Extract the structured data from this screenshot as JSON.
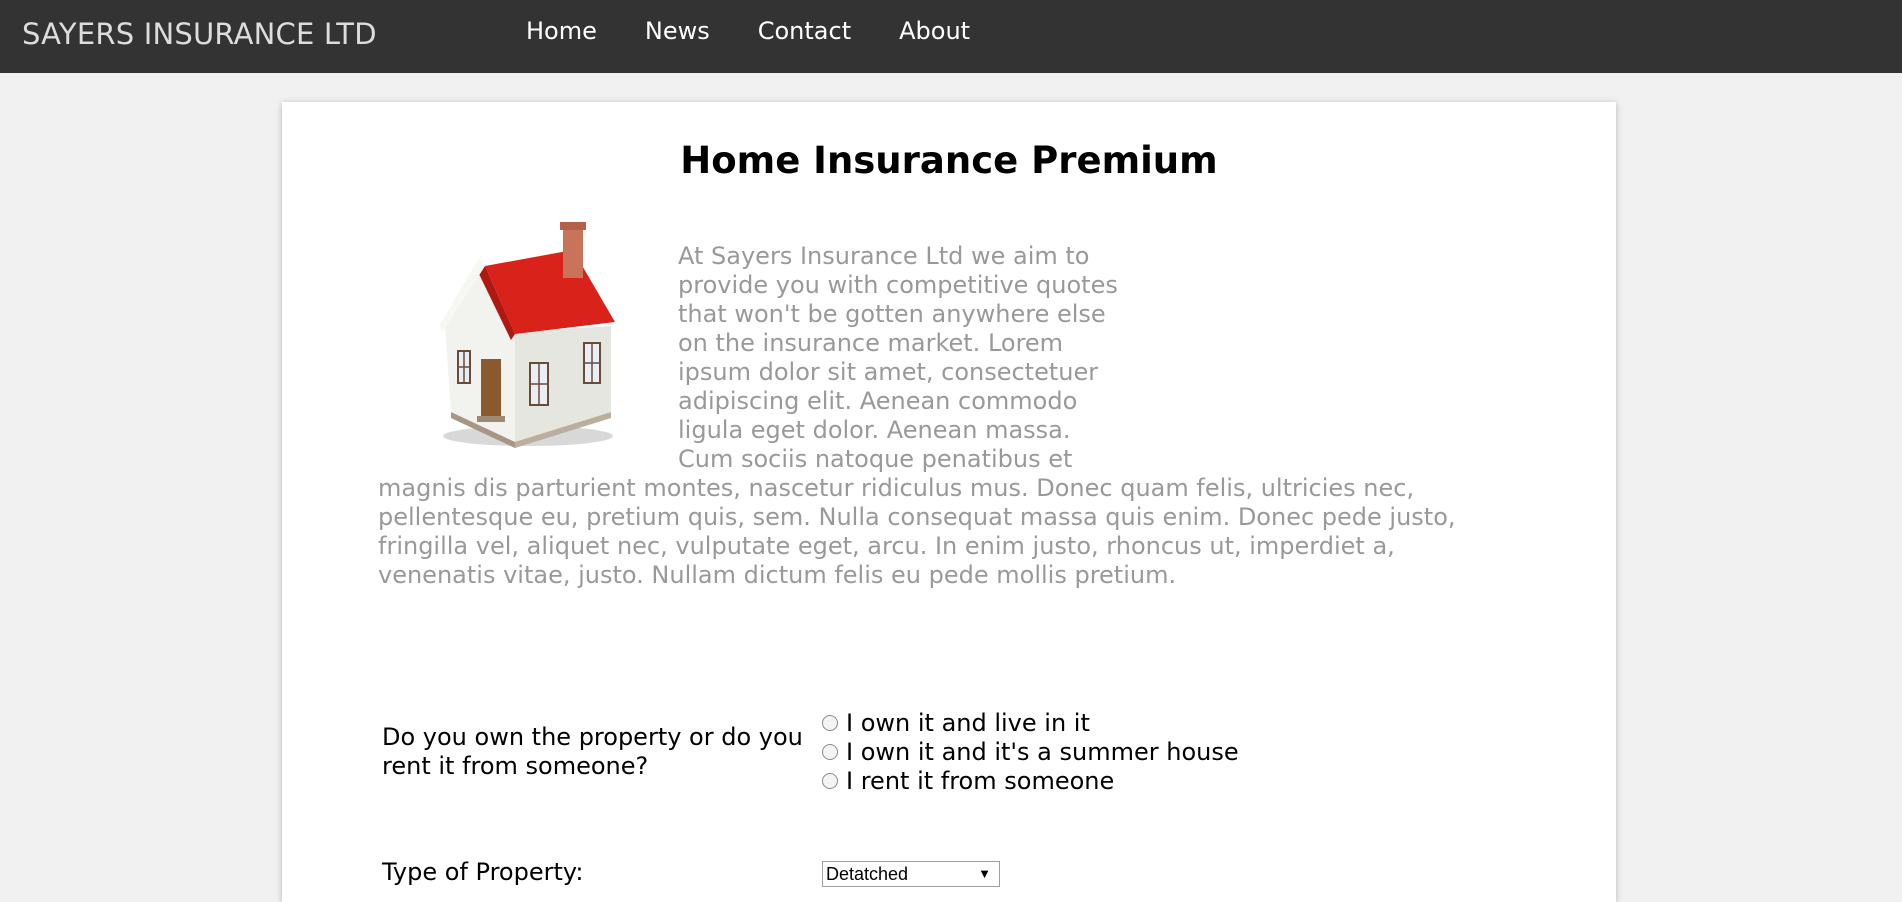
{
  "header": {
    "brand": "SAYERS INSURANCE LTD",
    "nav": [
      "Home",
      "News",
      "Contact",
      "About"
    ]
  },
  "main": {
    "title": "Home Insurance Premium",
    "intro_top": "At Sayers Insurance Ltd we aim to provide you with competitive quotes that won't be gotten anywhere else on the insurance market. Lorem ipsum dolor sit amet, consectetuer adipiscing elit. Aenean commodo ligula eget dolor. Aenean massa. Cum sociis natoque penatibus et",
    "intro_bottom": "magnis dis parturient montes, nascetur ridiculus mus. Donec quam felis, ultricies nec, pellentesque eu, pretium quis, sem. Nulla consequat massa quis enim. Donec pede justo, fringilla vel, aliquet nec, vulputate eget, arcu. In enim justo, rhoncus ut, imperdiet a, venenatis vitae, justo. Nullam dictum felis eu pede mollis pretium."
  },
  "form": {
    "ownership_question": "Do you own the property or do you rent it from someone?",
    "ownership_options": [
      "I own it and live in it",
      "I own it and it's a summer house",
      "I rent it from someone"
    ],
    "property_type_label": "Type of Property:",
    "property_type_value": "Detatched"
  },
  "colors": {
    "topbar": "#333333",
    "page_bg": "#f1f1f1",
    "intro_text": "#999999",
    "roof": "#d9231a"
  }
}
